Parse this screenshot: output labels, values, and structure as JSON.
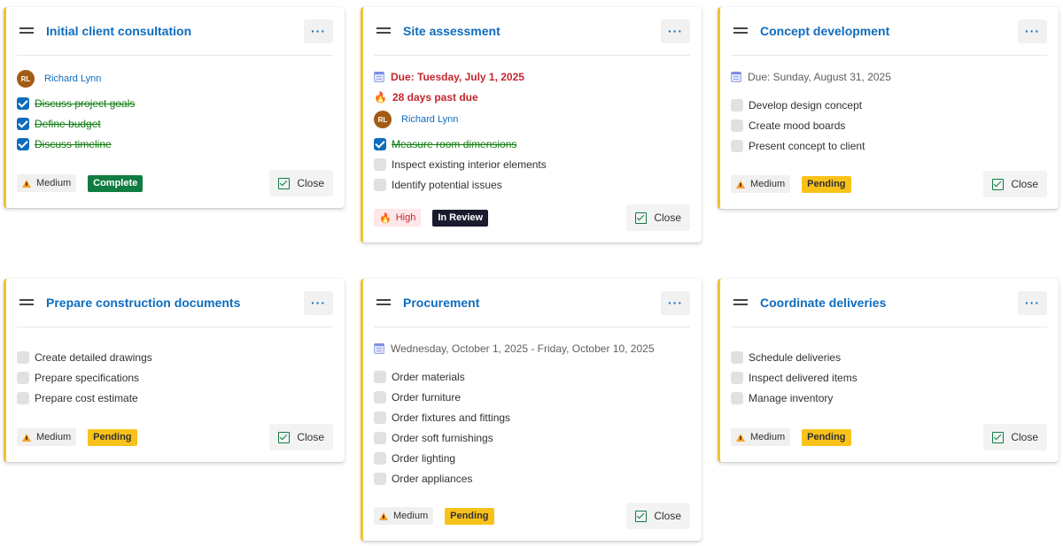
{
  "cards": [
    {
      "title": "Initial client consultation",
      "assignee": {
        "initials": "RL",
        "name": "Richard Lynn"
      },
      "items": [
        {
          "label": "Discuss project goals",
          "done": true
        },
        {
          "label": "Define budget",
          "done": true
        },
        {
          "label": "Discuss timeline",
          "done": true
        }
      ],
      "priority": "Medium",
      "status": "Complete",
      "close_label": "Close"
    },
    {
      "title": "Site assessment",
      "due": "Due: Tuesday, July 1, 2025",
      "overdue": "28 days past due",
      "assignee": {
        "initials": "RL",
        "name": "Richard Lynn"
      },
      "items": [
        {
          "label": "Measure room dimensions",
          "done": true
        },
        {
          "label": "Inspect existing interior elements",
          "done": false
        },
        {
          "label": "Identify potential issues",
          "done": false
        }
      ],
      "priority": "High",
      "status": "In Review",
      "close_label": "Close"
    },
    {
      "title": "Concept development",
      "due": "Due: Sunday, August 31, 2025",
      "items": [
        {
          "label": "Develop design concept",
          "done": false
        },
        {
          "label": "Create mood boards",
          "done": false
        },
        {
          "label": "Present concept to client",
          "done": false
        }
      ],
      "priority": "Medium",
      "status": "Pending",
      "close_label": "Close"
    },
    {
      "title": "Prepare construction documents",
      "items": [
        {
          "label": "Create detailed drawings",
          "done": false
        },
        {
          "label": "Prepare specifications",
          "done": false
        },
        {
          "label": "Prepare cost estimate",
          "done": false
        }
      ],
      "priority": "Medium",
      "status": "Pending",
      "close_label": "Close"
    },
    {
      "title": "Procurement",
      "date_range": "Wednesday, October 1, 2025 - Friday, October 10, 2025",
      "items": [
        {
          "label": "Order materials",
          "done": false
        },
        {
          "label": "Order furniture",
          "done": false
        },
        {
          "label": "Order fixtures and fittings",
          "done": false
        },
        {
          "label": "Order soft furnishings",
          "done": false
        },
        {
          "label": "Order lighting",
          "done": false
        },
        {
          "label": "Order appliances",
          "done": false
        }
      ],
      "priority": "Medium",
      "status": "Pending",
      "close_label": "Close"
    },
    {
      "title": "Coordinate deliveries",
      "items": [
        {
          "label": "Schedule deliveries",
          "done": false
        },
        {
          "label": "Inspect delivered items",
          "done": false
        },
        {
          "label": "Manage inventory",
          "done": false
        }
      ],
      "priority": "Medium",
      "status": "Pending",
      "close_label": "Close"
    }
  ],
  "icons": {
    "more": "ellipsis-icon",
    "drag": "drag-handle-icon",
    "calendar": "calendar-icon",
    "fire": "fire-icon",
    "warning": "warning-icon",
    "check": "checkbox-icon"
  }
}
